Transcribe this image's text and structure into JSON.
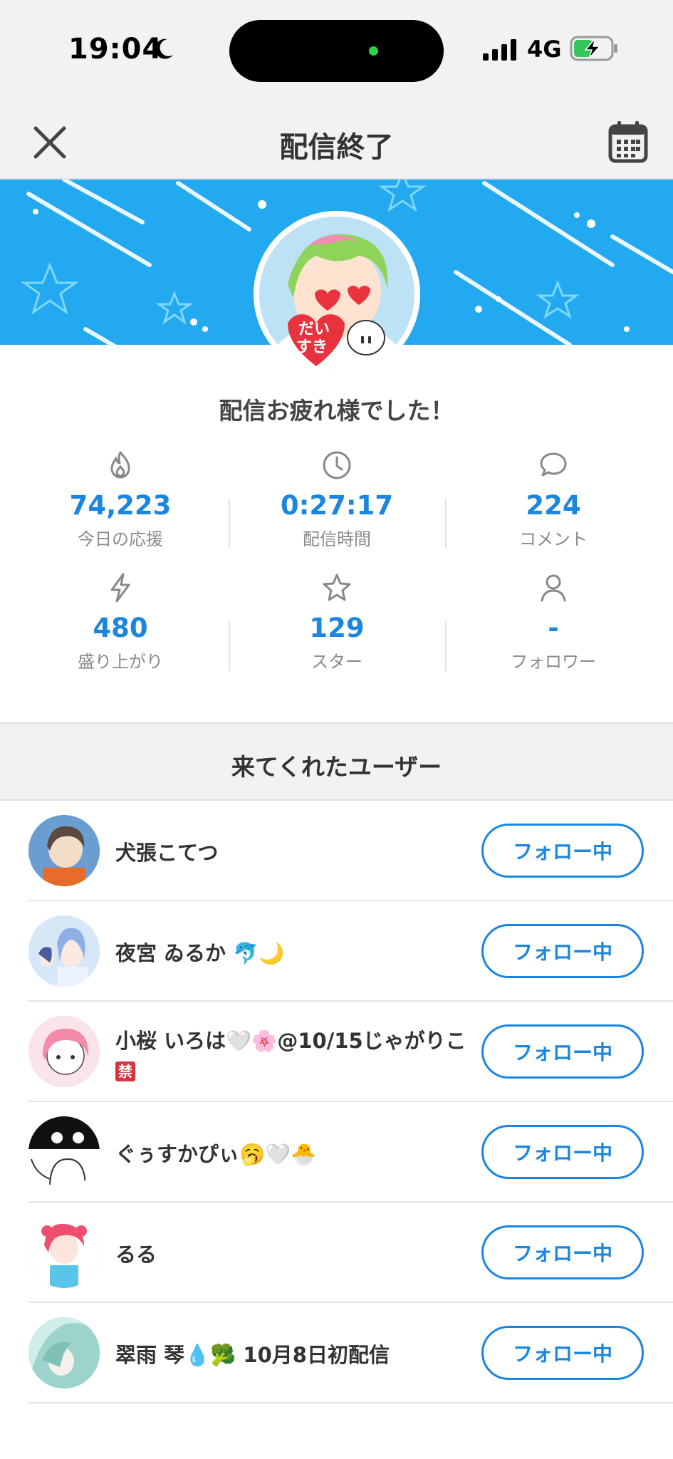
{
  "status_bar": {
    "time": "19:04",
    "network": "4G"
  },
  "header": {
    "title": "配信終了"
  },
  "summary": {
    "message": "配信お疲れ様でした！",
    "stats": [
      {
        "icon": "flame-icon",
        "value": "74,223",
        "label": "今日の応援"
      },
      {
        "icon": "clock-icon",
        "value": "0:27:17",
        "label": "配信時間"
      },
      {
        "icon": "comment-icon",
        "value": "224",
        "label": "コメント"
      },
      {
        "icon": "lightning-icon",
        "value": "480",
        "label": "盛り上がり"
      },
      {
        "icon": "star-icon",
        "value": "129",
        "label": "スター"
      },
      {
        "icon": "person-icon",
        "value": "-",
        "label": "フォロワー"
      }
    ]
  },
  "users_section": {
    "title": "来てくれたユーザー",
    "follow_label": "フォロー中",
    "users": [
      {
        "name": "犬張こてつ",
        "avatar_color": "#7aa3c9"
      },
      {
        "name": "夜宮 ゐるか 🐬🌙",
        "avatar_color": "#b9d4ef"
      },
      {
        "name": "小桜 いろは🤍🌸@10/15じゃがりこ",
        "badge": "禁",
        "avatar_color": "#f7b7c6"
      },
      {
        "name": "ぐぅすかぴぃ🥱🤍🐣",
        "avatar_color": "#dddddd"
      },
      {
        "name": "るる",
        "avatar_color": "#f58fa5"
      },
      {
        "name": "翠雨 琴💧🥦 10月8日初配信",
        "avatar_color": "#a8d8d0"
      }
    ]
  }
}
